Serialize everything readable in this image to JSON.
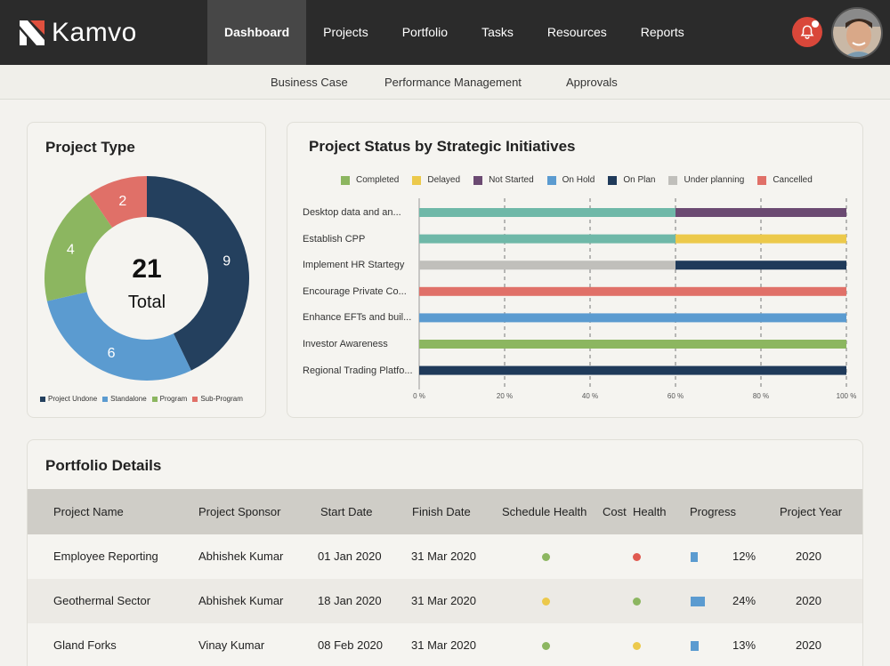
{
  "app": {
    "name": "Kamvo"
  },
  "nav": {
    "items": [
      {
        "label": "Dashboard",
        "active": true
      },
      {
        "label": "Projects",
        "active": false
      },
      {
        "label": "Portfolio",
        "active": false
      },
      {
        "label": "Tasks",
        "active": false
      },
      {
        "label": "Resources",
        "active": false
      },
      {
        "label": "Reports",
        "active": false
      }
    ]
  },
  "subnav": {
    "items": [
      "Business Case",
      "Performance Management",
      "Approvals"
    ]
  },
  "project_type": {
    "title": "Project Type",
    "total_value": "21",
    "total_label": "Total",
    "legend": [
      "Project Undone",
      "Standalone",
      "Program",
      "Sub-Program"
    ]
  },
  "status_chart": {
    "title": "Project Status by Strategic Initiatives",
    "legend": [
      {
        "label": "Completed",
        "color": "#8cb660"
      },
      {
        "label": "Delayed",
        "color": "#ecc94b"
      },
      {
        "label": "Not Started",
        "color": "#6b4a72"
      },
      {
        "label": "On Hold",
        "color": "#5b9bd0"
      },
      {
        "label": "On Plan",
        "color": "#1f3a5a"
      },
      {
        "label": "Under planning",
        "color": "#c0bfbb"
      },
      {
        "label": "Cancelled",
        "color": "#e07068"
      }
    ],
    "x_ticks": [
      "0 %",
      "20 %",
      "40 %",
      "60 %",
      "80 %",
      "100 %"
    ]
  },
  "chart_data": [
    {
      "type": "pie",
      "title": "Project Type",
      "categories": [
        "Project Undone",
        "Standalone",
        "Program",
        "Sub-Program"
      ],
      "values": [
        9,
        6,
        4,
        2
      ],
      "colors": [
        "#24405e",
        "#5b9bd0",
        "#8cb660",
        "#e07068"
      ],
      "total": 21
    },
    {
      "type": "bar",
      "title": "Project Status by Strategic Initiatives",
      "orientation": "horizontal",
      "stacked": true,
      "categories": [
        "Desktop data and an...",
        "Establish CPP",
        "Implement HR Startegy",
        "Encourage Private Co...",
        "Enhance EFTs and buil...",
        "Investor Awareness",
        "Regional Trading Platfo..."
      ],
      "series": [
        {
          "name": "Completed",
          "color": "#8cb660",
          "values": [
            0,
            0,
            0,
            0,
            0,
            100,
            0
          ]
        },
        {
          "name": "Delayed",
          "color": "#ecc94b",
          "values": [
            0,
            40,
            0,
            0,
            0,
            0,
            0
          ]
        },
        {
          "name": "Not Started",
          "color": "#6b4a72",
          "values": [
            40,
            0,
            0,
            0,
            0,
            0,
            0
          ]
        },
        {
          "name": "On Hold",
          "color": "#5b9bd0",
          "values": [
            0,
            0,
            0,
            0,
            100,
            0,
            0
          ]
        },
        {
          "name": "On Plan",
          "color": "#1f3a5a",
          "values": [
            0,
            0,
            40,
            0,
            0,
            0,
            100
          ]
        },
        {
          "name": "Under planning",
          "color": "#c0bfbb",
          "values": [
            0,
            0,
            60,
            0,
            0,
            0,
            0
          ]
        },
        {
          "name": "Cancelled",
          "color": "#e07068",
          "values": [
            0,
            0,
            0,
            100,
            0,
            0,
            0
          ]
        }
      ],
      "extra_segments_note_color": "#6fb8a8",
      "teal_segment_values": [
        60,
        60,
        0,
        0,
        0,
        0,
        0
      ],
      "xlim": [
        0,
        100
      ],
      "x_ticks": [
        "0 %",
        "20 %",
        "40 %",
        "60 %",
        "80 %",
        "100 %"
      ],
      "grid": true
    }
  ],
  "portfolio": {
    "title": "Portfolio Details",
    "columns": [
      "Project Name",
      "Project Sponsor",
      "Start Date",
      "Finish Date",
      "Schedule Health",
      "Cost  Health",
      "Progress",
      "Project Year"
    ],
    "rows": [
      {
        "name": "Employee Reporting",
        "sponsor": "Abhishek Kumar",
        "start": "01 Jan 2020",
        "finish": "31 Mar 2020",
        "schedule_color": "#8cb660",
        "cost_color": "#e05a50",
        "progress_pct": 12,
        "progress": "12%",
        "year": "2020"
      },
      {
        "name": "Geothermal Sector",
        "sponsor": "Abhishek Kumar",
        "start": "18 Jan 2020",
        "finish": "31 Mar 2020",
        "schedule_color": "#ecc94b",
        "cost_color": "#8cb660",
        "progress_pct": 24,
        "progress": "24%",
        "year": "2020"
      },
      {
        "name": "Gland Forks",
        "sponsor": "Vinay Kumar",
        "start": "08 Feb 2020",
        "finish": "31 Mar 2020",
        "schedule_color": "#8cb660",
        "cost_color": "#ecc94b",
        "progress_pct": 13,
        "progress": "13%",
        "year": "2020"
      }
    ]
  }
}
